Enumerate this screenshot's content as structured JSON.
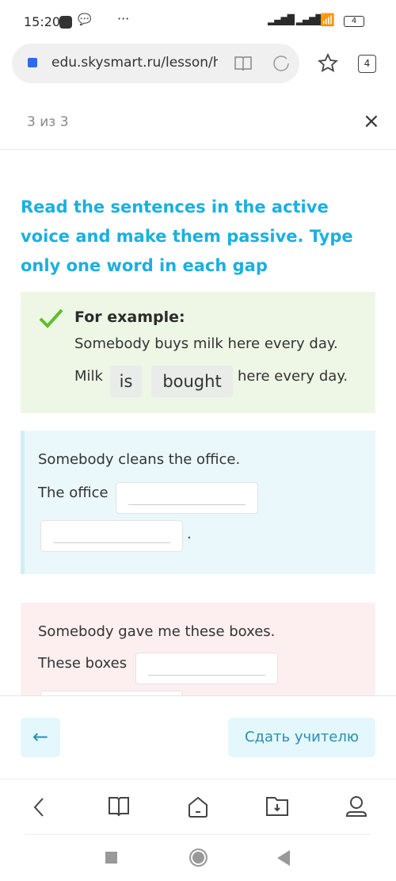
{
  "status_bar": {
    "time": "15:20",
    "battery": "4"
  },
  "browser": {
    "url": "edu.skysmart.ru/lesson/h",
    "tabs_count": "4"
  },
  "header": {
    "progress": "3 из 3",
    "close": "×"
  },
  "task": {
    "title": "Read the sentences in the active voice and make them passive. Type only one word in each gap"
  },
  "example": {
    "label": "For example:",
    "active": "Somebody buys milk here every day.",
    "prefix": "Milk",
    "answers": [
      "is",
      "bought"
    ],
    "suffix": "here every day."
  },
  "items": [
    {
      "active": "Somebody cleans the office.",
      "prefix": "The office",
      "suffix": ".",
      "values": [
        "",
        ""
      ]
    },
    {
      "active": "Somebody gave me these boxes.",
      "prefix": "These boxes",
      "values": [
        "",
        ""
      ]
    }
  ],
  "footer": {
    "back": "←",
    "submit": "Сдать учителю"
  },
  "colors": {
    "accent": "#1ab0e0",
    "example_bg": "#eef7e6",
    "blue_bg": "#eaf8fb",
    "pink_bg": "#fdeff0",
    "button_bg": "#e3f7fc",
    "button_text": "#2a8fb0"
  }
}
